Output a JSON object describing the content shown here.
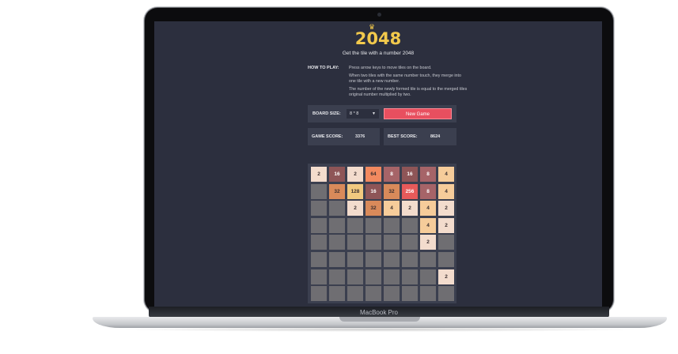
{
  "device": {
    "model_label": "MacBook Pro"
  },
  "game": {
    "title": "2048",
    "subtitle": "Get the tile with a number 2048",
    "how_to_play": {
      "label": "HOW TO PLAY:",
      "lines": [
        "Press arrow keys to move tiles on the board.",
        "When two tiles with the same number touch, they merge into one tile with a new number.",
        "The number of the newly formed tile is equal to the merged tiles original number multiplied by two."
      ]
    },
    "controls": {
      "board_size_label": "BOARD SIZE:",
      "board_size_value": "8 * 8",
      "new_game_label": "New Game"
    },
    "scores": {
      "game_score_label": "GAME SCORE:",
      "game_score": "3376",
      "best_score_label": "BEST SCORE:",
      "best_score": "8624"
    },
    "board": [
      [
        "2",
        "16",
        "2",
        "64",
        "8",
        "16",
        "8",
        "4"
      ],
      [
        "",
        "32",
        "128",
        "16",
        "32",
        "256",
        "8",
        "4"
      ],
      [
        "",
        "",
        "2",
        "32",
        "4",
        "2",
        "4",
        "2"
      ],
      [
        "",
        "",
        "",
        "",
        "",
        "",
        "4",
        "2"
      ],
      [
        "",
        "",
        "",
        "",
        "",
        "",
        "2",
        ""
      ],
      [
        "",
        "",
        "",
        "",
        "",
        "",
        "",
        ""
      ],
      [
        "",
        "",
        "",
        "",
        "",
        "",
        "",
        "2"
      ],
      [
        "",
        "",
        "",
        "",
        "",
        "",
        "",
        ""
      ]
    ],
    "tile_colors": {
      "empty": "#6f6e72",
      "2": "#f3dccd",
      "4": "#f6cc9a",
      "8": "#a66468",
      "16": "#8e5557",
      "32": "#d98a5a",
      "64": "#f2895f",
      "128": "#f1c97f",
      "256": "#e75a5a"
    },
    "accent": "#f2c94c"
  }
}
